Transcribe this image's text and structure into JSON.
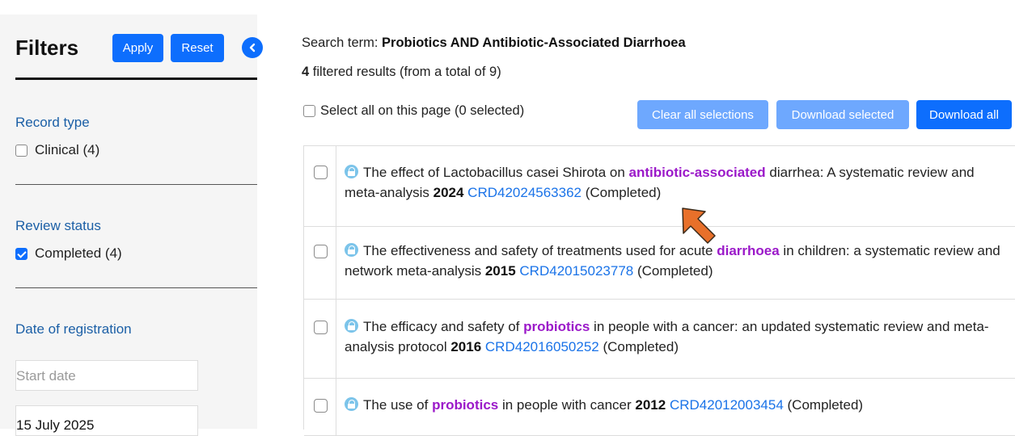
{
  "sidebar": {
    "title": "Filters",
    "apply_label": "Apply",
    "reset_label": "Reset",
    "collapse_icon": "chevron-left-icon",
    "record_type": {
      "label": "Record type",
      "option_label": "Clinical (4)",
      "checked": false
    },
    "review_status": {
      "label": "Review status",
      "option_label": "Completed (4)",
      "checked": true
    },
    "date_of_registration": {
      "label": "Date of registration",
      "start_placeholder": "Start date",
      "end_value": "15 July 2025"
    }
  },
  "main": {
    "search_term_prefix": "Search term: ",
    "search_term": "Probiotics AND Antibiotic-Associated Diarrhoea",
    "filtered_count": "4",
    "results_suffix": " filtered results (from a total of 9)",
    "select_all_label": "Select all on this page (0 selected)",
    "clear_all_label": "Clear all selections",
    "download_selected_label": "Download selected",
    "download_all_label": "Download all"
  },
  "results": [
    {
      "parts": [
        {
          "t": "The effect of Lactobacillus casei Shirota on ",
          "s": "plain"
        },
        {
          "t": "antibiotic-associated",
          "s": "hl"
        },
        {
          "t": " diarrhea: A systematic review and meta-analysis ",
          "s": "plain"
        },
        {
          "t": "2024",
          "s": "yr"
        },
        {
          "t": " ",
          "s": "plain"
        },
        {
          "t": "CRD42024563362",
          "s": "crd"
        },
        {
          "t": " (Completed)",
          "s": "plain"
        }
      ]
    },
    {
      "parts": [
        {
          "t": "The effectiveness and safety of treatments used for acute ",
          "s": "plain"
        },
        {
          "t": "diarrhoea",
          "s": "hl"
        },
        {
          "t": " in children: a systematic review and network meta-analysis ",
          "s": "plain"
        },
        {
          "t": "2015",
          "s": "yr"
        },
        {
          "t": " ",
          "s": "plain"
        },
        {
          "t": "CRD42015023778",
          "s": "crd"
        },
        {
          "t": " (Completed)",
          "s": "plain"
        }
      ]
    },
    {
      "parts": [
        {
          "t": "The efficacy and safety of ",
          "s": "plain"
        },
        {
          "t": "probiotics",
          "s": "hl"
        },
        {
          "t": " in people with a cancer: an updated systematic review and meta-analysis protocol ",
          "s": "plain"
        },
        {
          "t": "2016",
          "s": "yr"
        },
        {
          "t": " ",
          "s": "plain"
        },
        {
          "t": "CRD42016050252",
          "s": "crd"
        },
        {
          "t": " (Completed)",
          "s": "plain"
        }
      ]
    },
    {
      "parts": [
        {
          "t": "The use of ",
          "s": "plain"
        },
        {
          "t": "probiotics",
          "s": "hl"
        },
        {
          "t": " in people with cancer ",
          "s": "plain"
        },
        {
          "t": "2012",
          "s": "yr"
        },
        {
          "t": " ",
          "s": "plain"
        },
        {
          "t": "CRD42012003454",
          "s": "crd"
        },
        {
          "t": " (Completed)",
          "s": "plain"
        }
      ]
    }
  ],
  "colors": {
    "primary": "#0d6efd",
    "primary_light": "#6ea8fe",
    "highlight": "#9b19c9",
    "link": "#1a73e8",
    "section_label": "#1b5fa6",
    "cursor_arrow": "#e8702a"
  }
}
